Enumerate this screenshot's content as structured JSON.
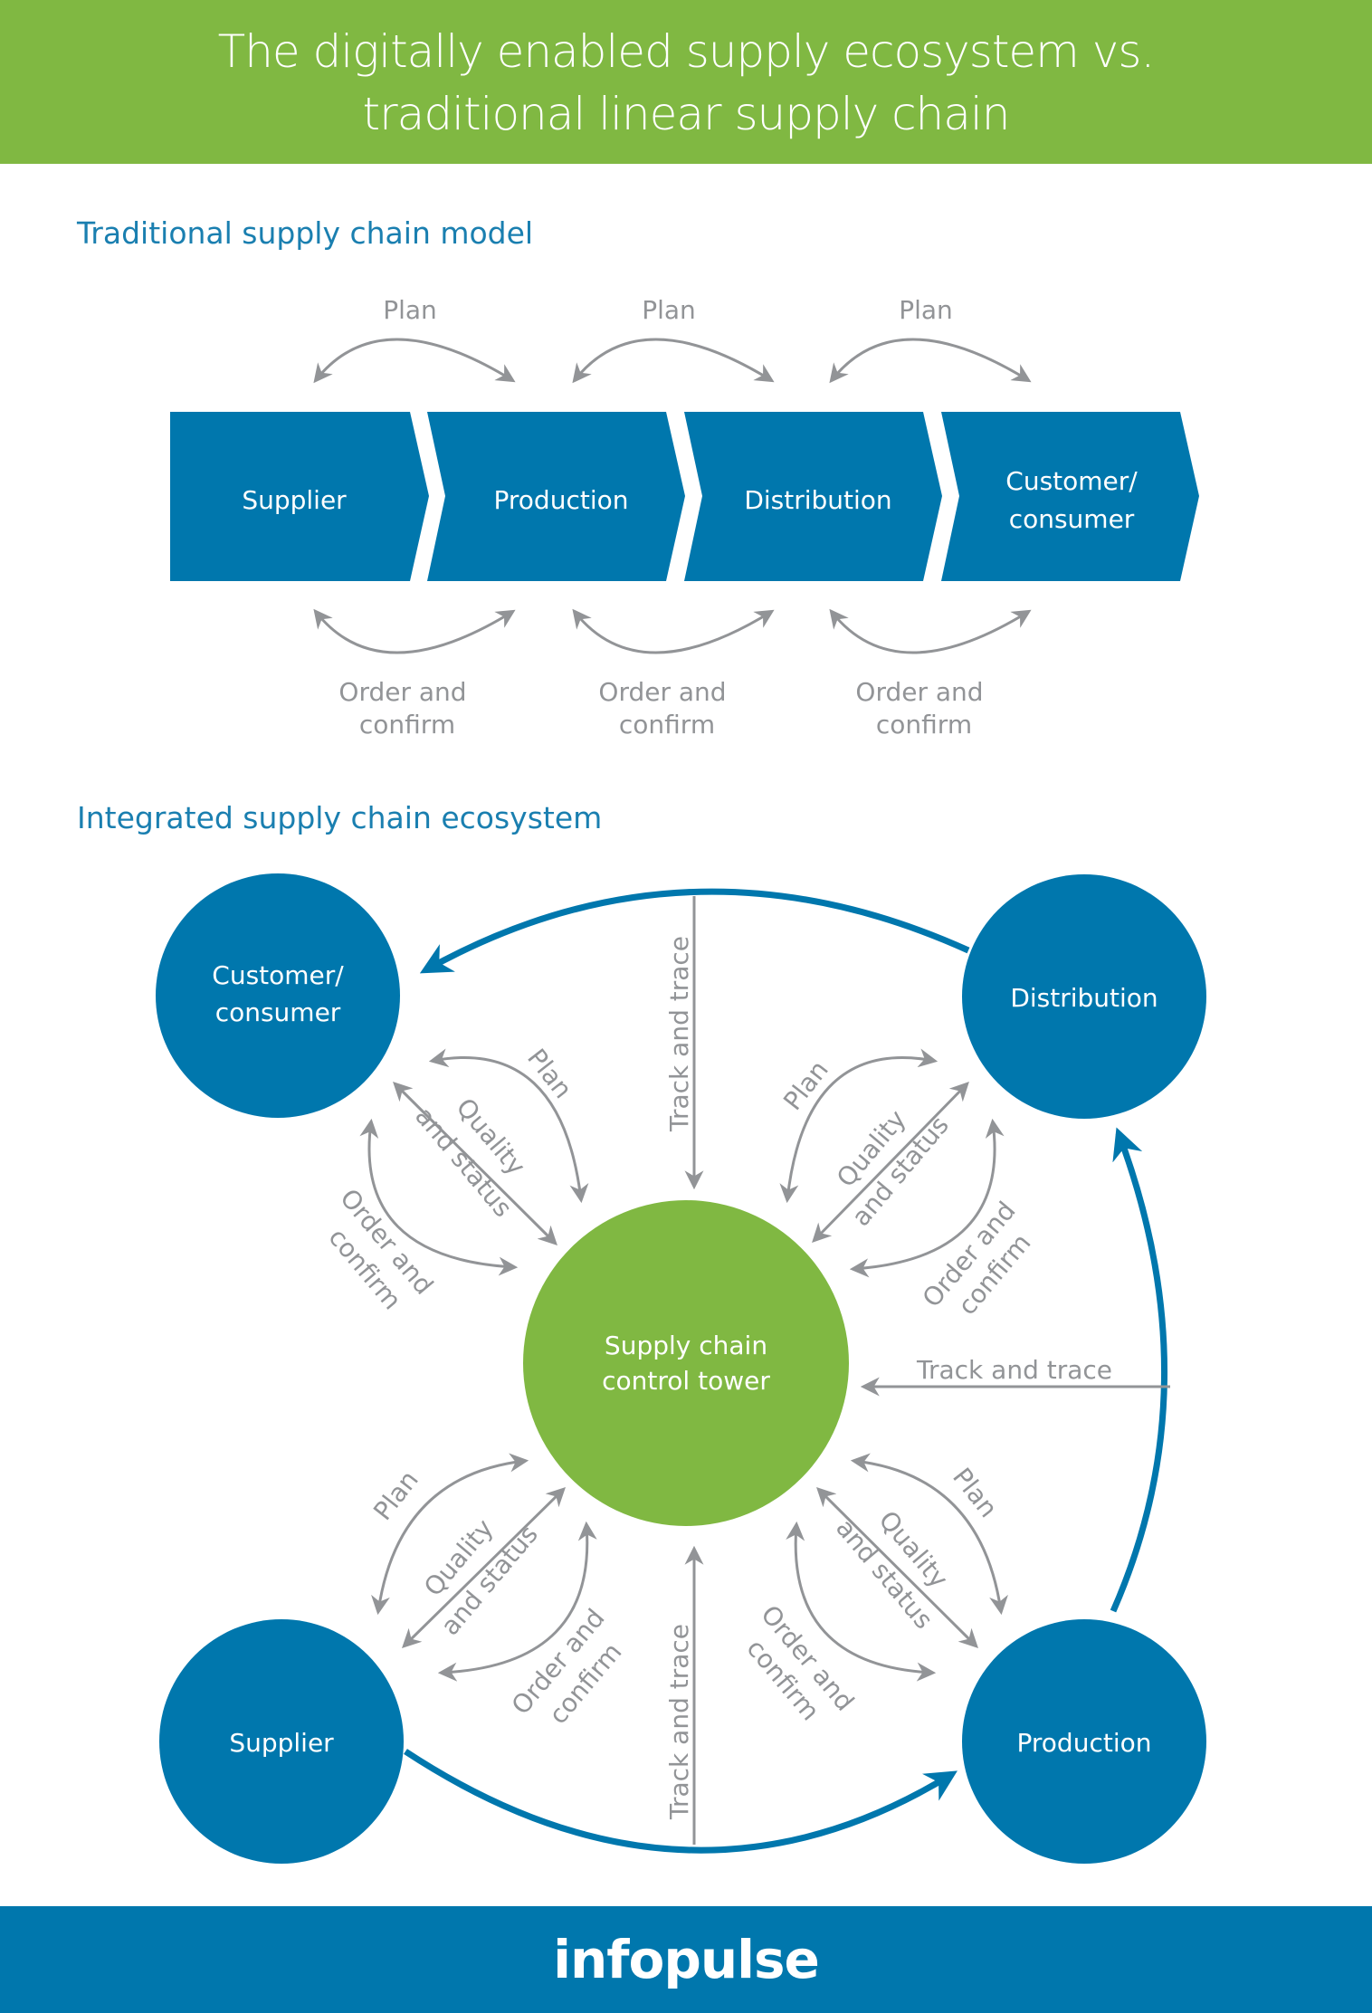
{
  "header": {
    "title_line1": "The digitally enabled supply ecosystem vs.",
    "title_line2": "traditional linear supply chain"
  },
  "colors": {
    "green": "#80b842",
    "blue": "#0077ad",
    "heading_blue": "#1a7fb0",
    "gray": "#929497"
  },
  "traditional": {
    "heading": "Traditional supply chain model",
    "stages": [
      {
        "line1": "Supplier",
        "line2": ""
      },
      {
        "line1": "Production",
        "line2": ""
      },
      {
        "line1": "Distribution",
        "line2": ""
      },
      {
        "line1": "Customer/",
        "line2": "consumer"
      }
    ],
    "plan_labels": [
      "Plan",
      "Plan",
      "Plan"
    ],
    "order_labels": [
      {
        "line1": "Order and",
        "line2": "confirm"
      },
      {
        "line1": "Order and",
        "line2": "confirm"
      },
      {
        "line1": "Order and",
        "line2": "confirm"
      }
    ]
  },
  "integrated": {
    "heading": "Integrated supply chain ecosystem",
    "center": {
      "line1": "Supply chain",
      "line2": "control tower"
    },
    "nodes": {
      "customer": {
        "line1": "Customer/",
        "line2": "consumer"
      },
      "distribution": {
        "line1": "Distribution",
        "line2": ""
      },
      "supplier": {
        "line1": "Supplier",
        "line2": ""
      },
      "production": {
        "line1": "Production",
        "line2": ""
      }
    },
    "flow_labels": {
      "plan": "Plan",
      "quality_line1": "Quality",
      "quality_line2": "and status",
      "order_line1": "Order and",
      "order_line2": "confirm",
      "track": "Track and trace"
    }
  },
  "footer": {
    "logo": "infopulse"
  }
}
